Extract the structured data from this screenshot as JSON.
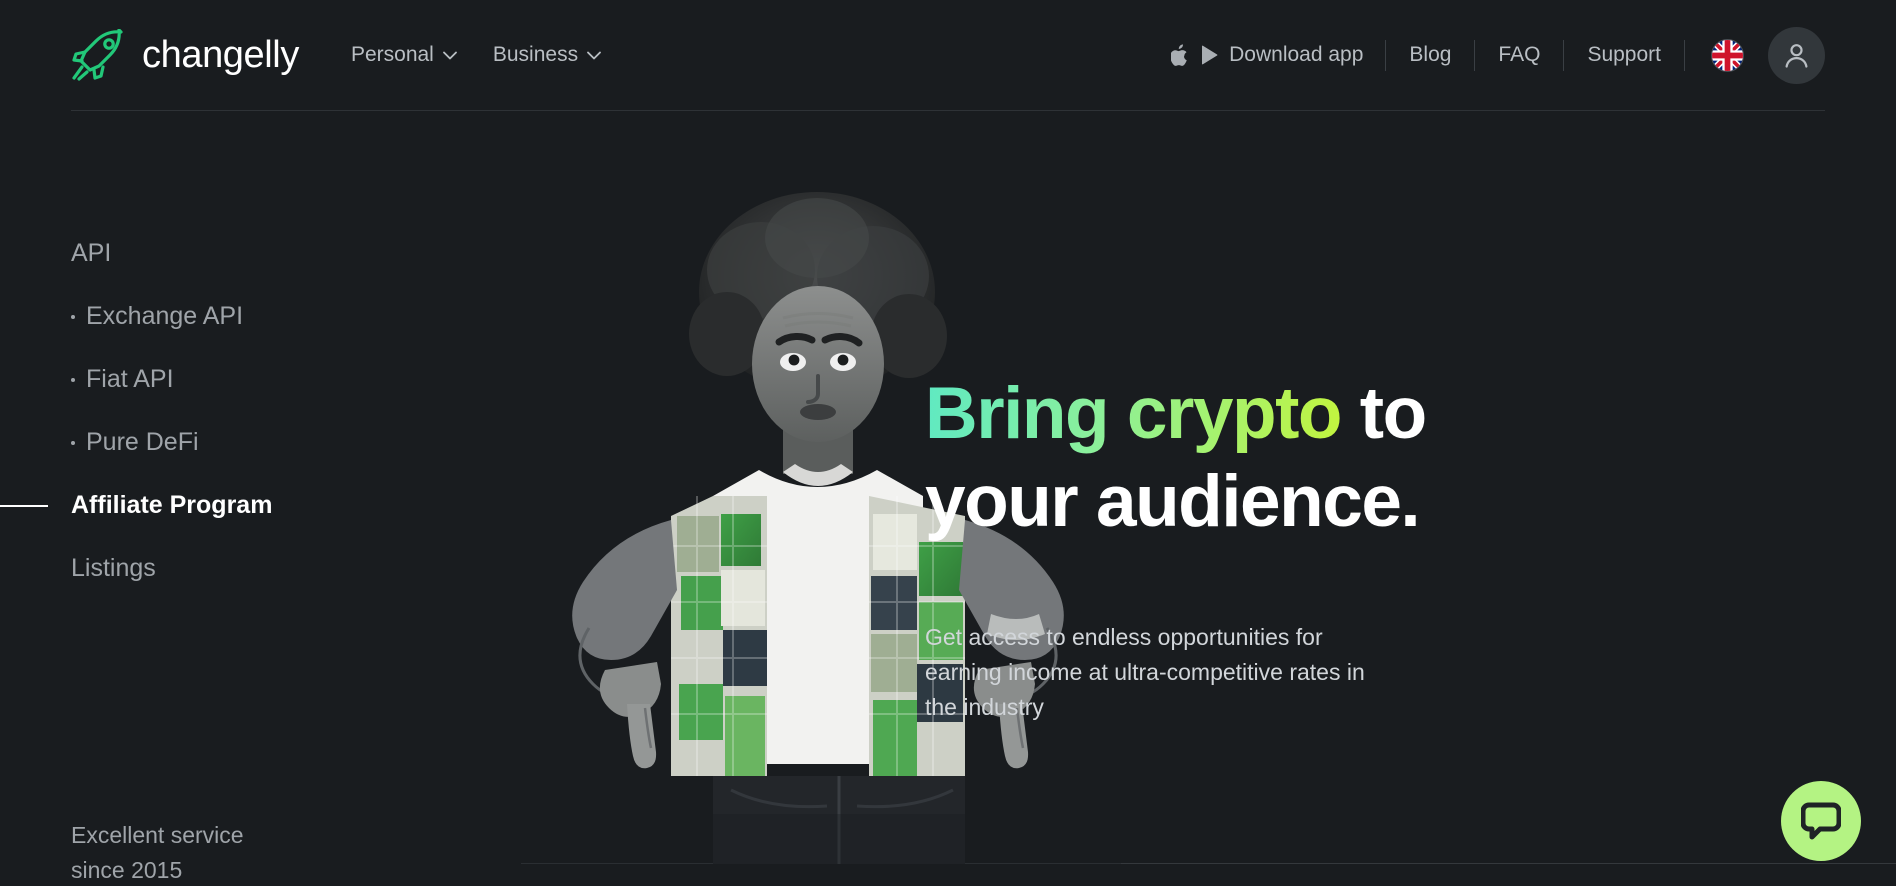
{
  "brand": {
    "name": "changelly",
    "logo_icon": "rocket-icon",
    "logo_color": "#22c879",
    "accent_gradient_from": "#5fe9c2",
    "accent_gradient_to": "#c2f43e",
    "background": "#191c1f"
  },
  "header": {
    "nav": [
      {
        "label": "Personal",
        "icon": "chevron-down-icon"
      },
      {
        "label": "Business",
        "icon": "chevron-down-icon"
      }
    ],
    "download": {
      "label": "Download app",
      "apple_icon": "apple-icon",
      "play_icon": "google-play-icon"
    },
    "links": [
      {
        "label": "Blog"
      },
      {
        "label": "FAQ"
      },
      {
        "label": "Support"
      }
    ],
    "language": {
      "icon": "uk-flag-icon",
      "label": "EN"
    },
    "account": {
      "icon": "user-avatar-icon"
    }
  },
  "sidebar": {
    "items": [
      {
        "label": "API",
        "level": "top",
        "active": false
      },
      {
        "label": "Exchange API",
        "level": "sub",
        "active": false
      },
      {
        "label": "Fiat API",
        "level": "sub",
        "active": false
      },
      {
        "label": "Pure DeFi",
        "level": "sub",
        "active": false
      },
      {
        "label": "Affiliate Program",
        "level": "top",
        "active": true
      },
      {
        "label": "Listings",
        "level": "top",
        "active": false
      }
    ],
    "tagline": "Excellent service\nsince 2015"
  },
  "hero": {
    "headline_line1_gradient": "Bring crypto",
    "headline_line1_plain": " to",
    "headline_line2": "your audience.",
    "subcopy": "Get access to endless opportunities for\nearning income at ultra-competitive rates in\nthe industry",
    "image_alt": "person-pointing-down-photo"
  },
  "chat": {
    "icon": "chat-bubble-icon",
    "color": "#b4f383"
  }
}
